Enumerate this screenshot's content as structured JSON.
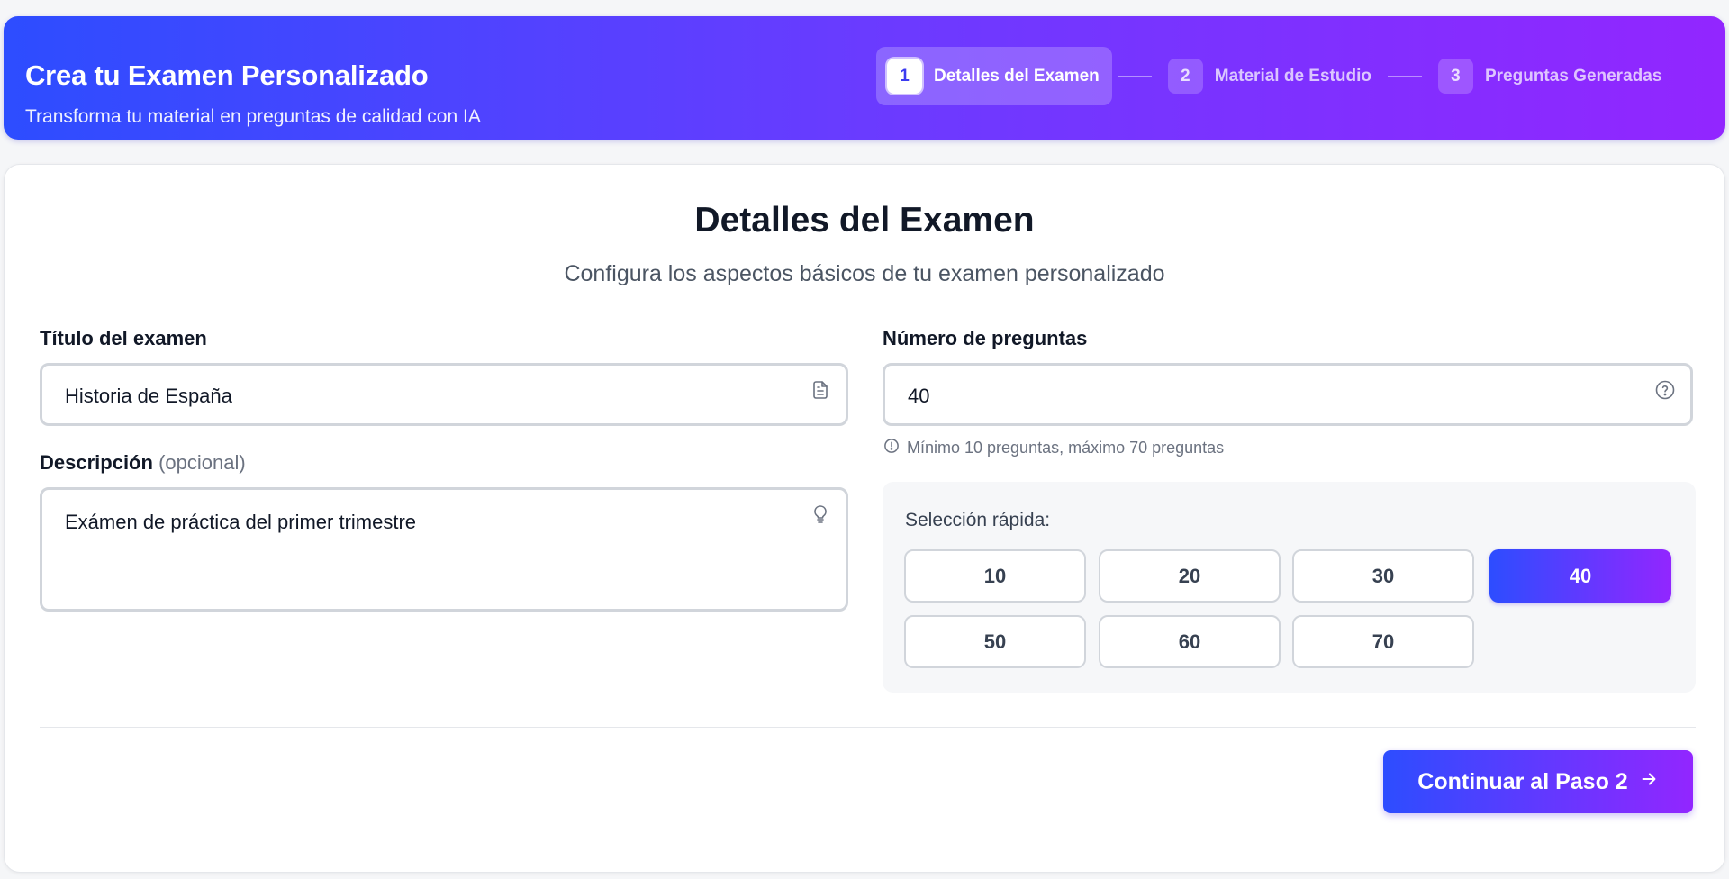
{
  "header": {
    "title": "Crea tu Examen Personalizado",
    "subtitle": "Transforma tu material en preguntas de calidad con IA"
  },
  "steps": [
    {
      "number": "1",
      "label": "Detalles del Examen",
      "active": true
    },
    {
      "number": "2",
      "label": "Material de Estudio",
      "active": false
    },
    {
      "number": "3",
      "label": "Preguntas Generadas",
      "active": false
    }
  ],
  "main": {
    "heading": "Detalles del Examen",
    "subheading": "Configura los aspectos básicos de tu examen personalizado"
  },
  "title_field": {
    "label": "Título del examen",
    "value": "Historia de España",
    "icon": "document-icon"
  },
  "description_field": {
    "label": "Descripción",
    "optional": "(opcional)",
    "value": "Exámen de práctica del primer trimestre",
    "icon": "lightbulb-icon"
  },
  "questions_field": {
    "label": "Número de preguntas",
    "value": "40",
    "icon": "help-circle-icon",
    "hint": "Mínimo 10 preguntas, máximo 70 preguntas",
    "hint_icon": "info-circle-icon"
  },
  "quick_select": {
    "label": "Selección rápida:",
    "options": [
      "10",
      "20",
      "30",
      "40",
      "50",
      "60",
      "70"
    ],
    "selected": "40"
  },
  "continue_button": {
    "label": "Continuar al Paso 2",
    "icon": "arrow-right-icon"
  },
  "colors": {
    "gradient_start": "#2d4dff",
    "gradient_end": "#9226ff"
  }
}
